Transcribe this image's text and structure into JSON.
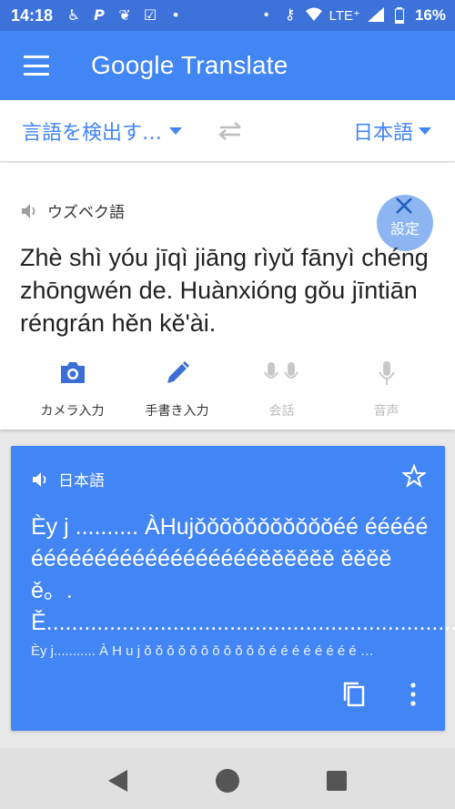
{
  "status_bar": {
    "time": "14:18",
    "network": "LTE⁺",
    "battery": "16%"
  },
  "app_bar": {
    "title_google": "Google",
    "title_translate": "Translate"
  },
  "language_bar": {
    "source_language": "言語を検出す…",
    "target_language": "日本語"
  },
  "source": {
    "detected_language": "ウズベク語",
    "settings_label": "設定",
    "text": "Zhè shì yóu jīqì jiāng rìyǔ fānyì chéng zhōngwén de. Huànxióng gǒu jīntiān réngrán hěn kě'ài.",
    "tools": {
      "camera": "カメラ入力",
      "handwriting": "手書き入力",
      "conversation": "会話",
      "voice": "音声"
    }
  },
  "result": {
    "language": "日本語",
    "text": "Èy j ..........  ÀHujǒǒǒǒǒǒǒǒǒǒǒéé éééééééééééééééééééééééěěěěěě ěěěěě。. Ě..................................................................",
    "transliteration": "Èy j........... À H u j ǒ ǒ ǒ ǒ ǒ ǒ ǒ ǒ ǒ ǒ ǒ é é é é é é é é …"
  },
  "colors": {
    "primary": "#4285f4",
    "status_bar": "#3c72da",
    "disabled": "#c8c8c8"
  }
}
